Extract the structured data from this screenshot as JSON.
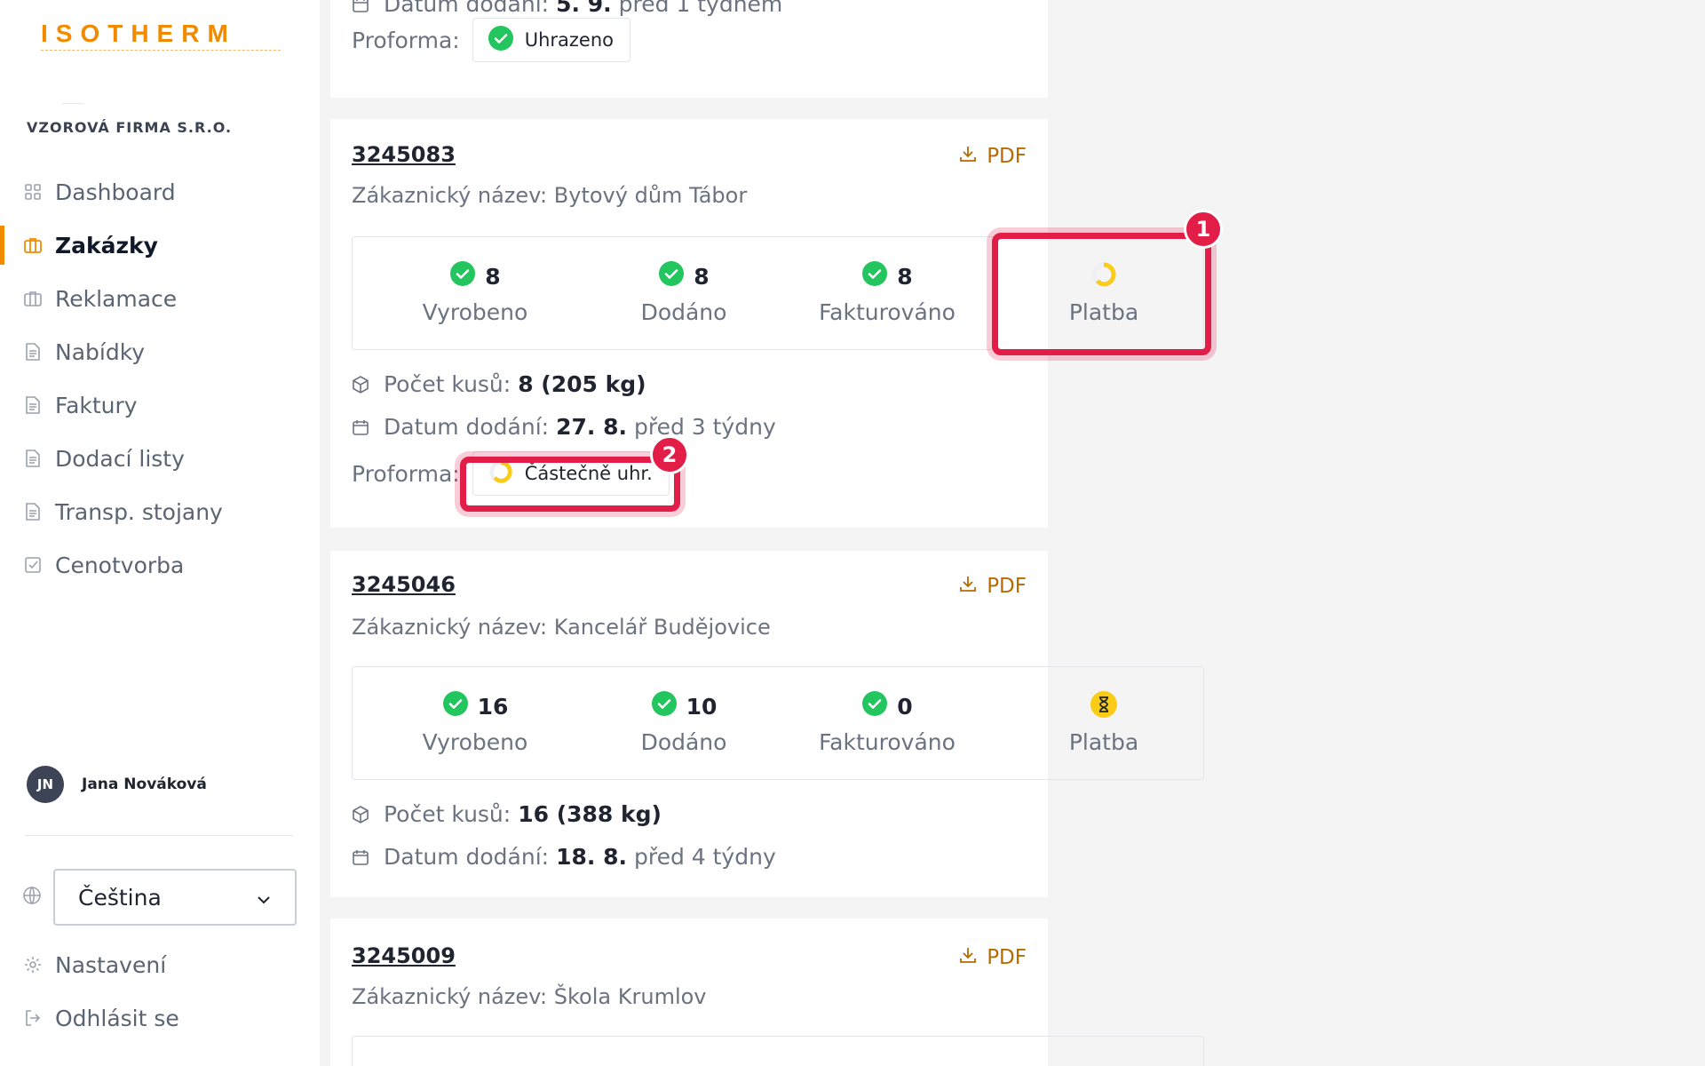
{
  "brand": {
    "logo": "ISOTHERM",
    "company": "VZOROVÁ FIRMA S.R.O."
  },
  "nav": [
    {
      "label": "Dashboard",
      "icon": "grid-icon"
    },
    {
      "label": "Zakázky",
      "icon": "briefcase-icon",
      "active": true
    },
    {
      "label": "Reklamace",
      "icon": "briefcase-icon"
    },
    {
      "label": "Nabídky",
      "icon": "document-icon"
    },
    {
      "label": "Faktury",
      "icon": "document-icon"
    },
    {
      "label": "Dodací listy",
      "icon": "document-icon"
    },
    {
      "label": "Transp. stojany",
      "icon": "document-icon"
    },
    {
      "label": "Cenotvorba",
      "icon": "checkbox-icon"
    }
  ],
  "user": {
    "initials": "JN",
    "name": "Jana Nováková"
  },
  "language": {
    "selected": "Čeština"
  },
  "bottom_nav": {
    "settings": "Nastavení",
    "logout": "Odhlásit se"
  },
  "labels": {
    "pdf": "PDF",
    "customer_prefix": "Zákaznický název:",
    "pieces": "Počet kusů:",
    "delivery": "Datum dodání:",
    "proforma": "Proforma:",
    "produced": "Vyrobeno",
    "delivered": "Dodáno",
    "invoiced": "Fakturováno",
    "payment": "Platba"
  },
  "top_card": {
    "delivery_value": "5. 9.",
    "delivery_rel": "před 1 týdnem",
    "proforma_status": "Uhrazeno"
  },
  "orders": [
    {
      "id": "3245083",
      "customer": "Bytový dům Tábor",
      "produced": "8",
      "delivered": "8",
      "invoiced": "8",
      "payment_status": "partial",
      "pieces": "8 (205 kg)",
      "delivery_value": "27. 8.",
      "delivery_rel": "před 3 týdny",
      "proforma_status": "Částečně uhr."
    },
    {
      "id": "3245046",
      "customer": "Kancelář Budějovice",
      "produced": "16",
      "delivered": "10",
      "invoiced": "0",
      "payment_status": "pending",
      "pieces": "16 (388 kg)",
      "delivery_value": "18. 8.",
      "delivery_rel": "před 4 týdny"
    },
    {
      "id": "3245009",
      "customer": "Škola Krumlov"
    }
  ],
  "annotations": [
    "1",
    "2"
  ],
  "colors": {
    "accent": "#f28a00",
    "success": "#22c55e",
    "partial": "#facc15",
    "highlight": "#e11d48"
  }
}
